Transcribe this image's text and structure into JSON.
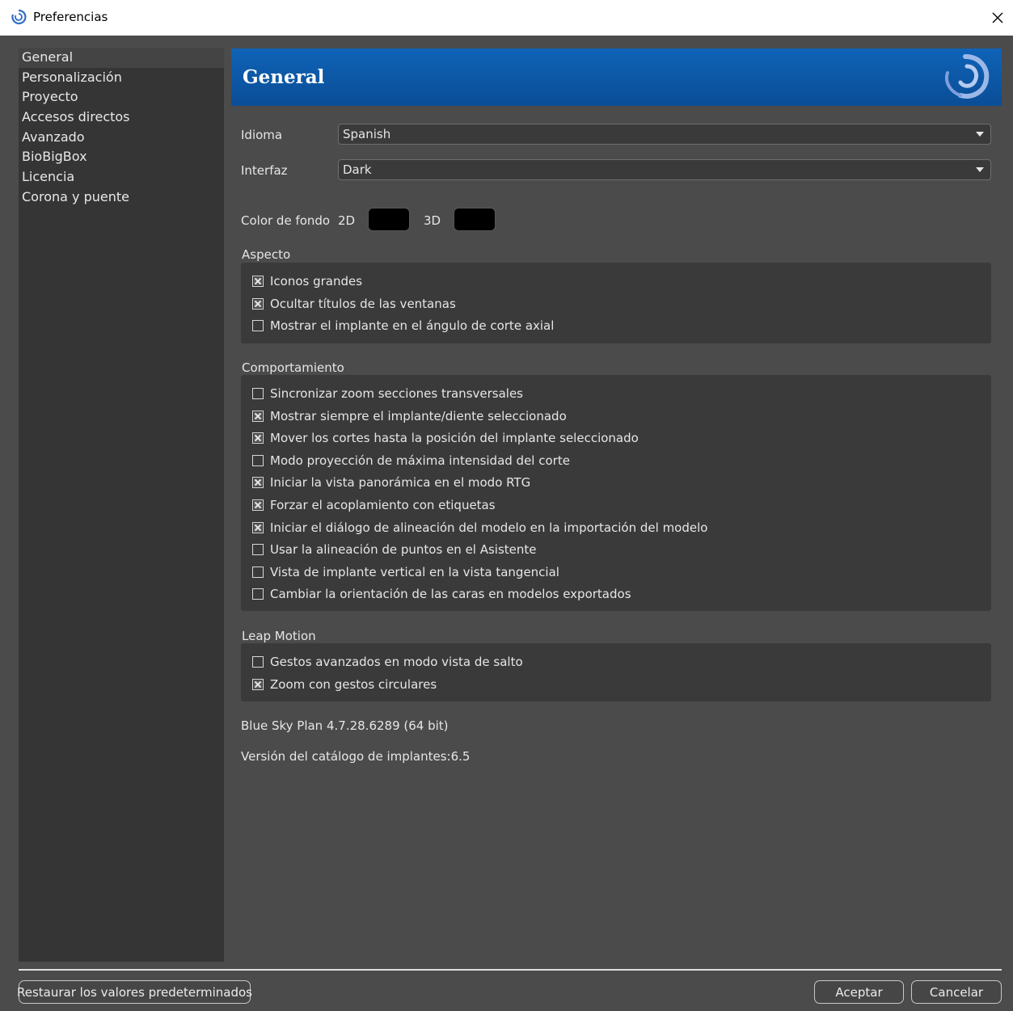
{
  "window": {
    "title": "Preferencias",
    "close_glyph": "✕"
  },
  "sidebar": {
    "items": [
      {
        "label": "General"
      },
      {
        "label": "Personalización"
      },
      {
        "label": "Proyecto"
      },
      {
        "label": "Accesos directos"
      },
      {
        "label": "Avanzado"
      },
      {
        "label": "BioBigBox"
      },
      {
        "label": "Licencia"
      },
      {
        "label": "Corona y puente"
      }
    ],
    "selected": "General"
  },
  "header": {
    "title": "General"
  },
  "settings": {
    "language": {
      "label": "Idioma",
      "value": "Spanish"
    },
    "interface": {
      "label": "Interfaz",
      "value": "Dark"
    },
    "background_color": {
      "label": "Color de fondo",
      "label_2d": "2D",
      "label_3d": "3D",
      "color_2d": "#000000",
      "color_3d": "#000000"
    }
  },
  "aspect": {
    "title": "Aspecto",
    "options": [
      {
        "label": "Iconos grandes",
        "checked": true
      },
      {
        "label": "Ocultar títulos de las ventanas",
        "checked": true
      },
      {
        "label": "Mostrar el implante en el ángulo de corte axial",
        "checked": false
      }
    ]
  },
  "behavior": {
    "title": "Comportamiento",
    "options": [
      {
        "label": "Sincronizar zoom secciones transversales",
        "checked": false
      },
      {
        "label": "Mostrar siempre el implante/diente seleccionado",
        "checked": true
      },
      {
        "label": "Mover los cortes hasta la posición del implante seleccionado",
        "checked": true
      },
      {
        "label": "Modo proyección de máxima intensidad del corte",
        "checked": false
      },
      {
        "label": "Iniciar la vista panorámica en el modo RTG",
        "checked": true
      },
      {
        "label": "Forzar el acoplamiento con etiquetas",
        "checked": true
      },
      {
        "label": "Iniciar el diálogo de alineación del modelo en la importación del modelo",
        "checked": true
      },
      {
        "label": "Usar la alineación de puntos en el Asistente",
        "checked": false
      },
      {
        "label": "Vista de implante vertical en la vista tangencial",
        "checked": false
      },
      {
        "label": "Cambiar la orientación de las caras en modelos exportados",
        "checked": false
      }
    ]
  },
  "leap_motion": {
    "title": "Leap Motion",
    "options": [
      {
        "label": "Gestos avanzados en modo vista de salto",
        "checked": false
      },
      {
        "label": "Zoom con gestos circulares",
        "checked": true
      }
    ]
  },
  "info": {
    "version": "Blue Sky Plan 4.7.28.6289 (64 bit)",
    "catalog_version": "Versión del catálogo de implantes:6.5"
  },
  "footer": {
    "restore_label": "Restaurar los valores predeterminados",
    "accept_label": "Aceptar",
    "cancel_label": "Cancelar"
  },
  "colors": {
    "banner": "#0f63b7",
    "sidebar_bg": "#353535",
    "content_bg": "#4b4b4b",
    "group_bg": "#3a3a3a"
  }
}
